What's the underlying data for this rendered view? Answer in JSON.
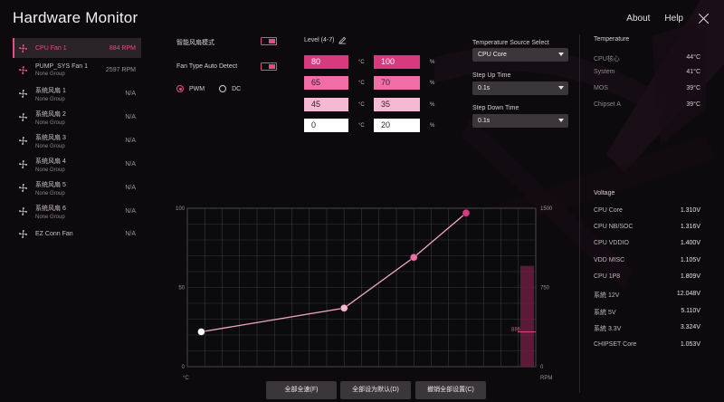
{
  "app": {
    "title": "Hardware Monitor"
  },
  "topnav": {
    "about": "About",
    "help": "Help"
  },
  "fans": [
    {
      "name": "CPU Fan 1",
      "group": "",
      "value": "884 RPM",
      "active": true
    },
    {
      "name": "PUMP_SYS Fan 1",
      "group": "None Group",
      "value": "2597 RPM",
      "active": false
    },
    {
      "name": "系统风扇 1",
      "group": "None Group",
      "value": "N/A",
      "active": false
    },
    {
      "name": "系统风扇 2",
      "group": "None Group",
      "value": "N/A",
      "active": false
    },
    {
      "name": "系统风扇 3",
      "group": "None Group",
      "value": "N/A",
      "active": false
    },
    {
      "name": "系统风扇 4",
      "group": "None Group",
      "value": "N/A",
      "active": false
    },
    {
      "name": "系统风扇 5",
      "group": "None Group",
      "value": "N/A",
      "active": false
    },
    {
      "name": "系统风扇 6",
      "group": "None Group",
      "value": "N/A",
      "active": false
    },
    {
      "name": "EZ Conn Fan",
      "group": "",
      "value": "N/A",
      "active": false
    }
  ],
  "controls": {
    "smart_mode_label": "智能风扇模式",
    "auto_detect_label": "Fan Type Auto Detect",
    "pwm_label": "PWM",
    "dc_label": "DC",
    "level_label": "Level (4-7)",
    "temp_unit": "°C",
    "pct_unit": "%"
  },
  "levels": [
    {
      "temp": "80",
      "pct": "100",
      "color": "#d83a7e",
      "text": "#ffffff"
    },
    {
      "temp": "65",
      "pct": "70",
      "color": "#f06ea6",
      "text": "#3a1a28"
    },
    {
      "temp": "45",
      "pct": "35",
      "color": "#f6b8d2",
      "text": "#3a1a28"
    },
    {
      "temp": "0",
      "pct": "20",
      "color": "#ffffff",
      "text": "#2a2a2a"
    }
  ],
  "temp_source": {
    "label": "Temperature Source Select",
    "value": "CPU Core",
    "step_up_label": "Step Up Time",
    "step_up_value": "0.1s",
    "step_down_label": "Step Down Time",
    "step_down_value": "0.1s"
  },
  "temperature": {
    "title": "Temperature",
    "rows": [
      {
        "name": "CPU核心",
        "value": "44°C"
      },
      {
        "name": "System",
        "value": "41°C"
      },
      {
        "name": "MOS",
        "value": "39°C"
      },
      {
        "name": "Chipset A",
        "value": "39°C"
      }
    ]
  },
  "voltage": {
    "title": "Voltage",
    "rows": [
      {
        "name": "CPU Core",
        "value": "1.310V"
      },
      {
        "name": "CPU NB/SOC",
        "value": "1.316V"
      },
      {
        "name": "CPU VDDIO",
        "value": "1.400V"
      },
      {
        "name": "VDD MISC",
        "value": "1.105V"
      },
      {
        "name": "CPU 1P8",
        "value": "1.809V"
      },
      {
        "name": "系統 12V",
        "value": "12.048V"
      },
      {
        "name": "系統 5V",
        "value": "5.110V"
      },
      {
        "name": "系統 3.3V",
        "value": "3.324V"
      },
      {
        "name": "CHIPSET Core",
        "value": "1.053V"
      }
    ]
  },
  "chart_data": {
    "type": "line",
    "x_unit": "°C",
    "y_unit": "%",
    "y2_unit": "RPM",
    "y_ticks": [
      "100",
      "50",
      "0"
    ],
    "y2_ticks": [
      "1500",
      "750",
      "0"
    ],
    "xlim": [
      0,
      100
    ],
    "ylim": [
      0,
      100
    ],
    "y2lim": [
      0,
      1500
    ],
    "points": [
      {
        "x": 4,
        "y": 22,
        "color": "#ffffff"
      },
      {
        "x": 45,
        "y": 37,
        "color": "#f6b8d2"
      },
      {
        "x": 65,
        "y": 69,
        "color": "#f06ea6"
      },
      {
        "x": 80,
        "y": 97,
        "color": "#d83a7e"
      }
    ],
    "rpm_label": "886",
    "rpm_value": 886,
    "grid": true
  },
  "buttons": {
    "full_speed": "全部全速(F)",
    "set_default": "全部设为默认(D)",
    "cancel_all": "撤销全部设置(C)"
  },
  "colors": {
    "accent": "#e04e8a",
    "background": "#0c0a0d"
  }
}
